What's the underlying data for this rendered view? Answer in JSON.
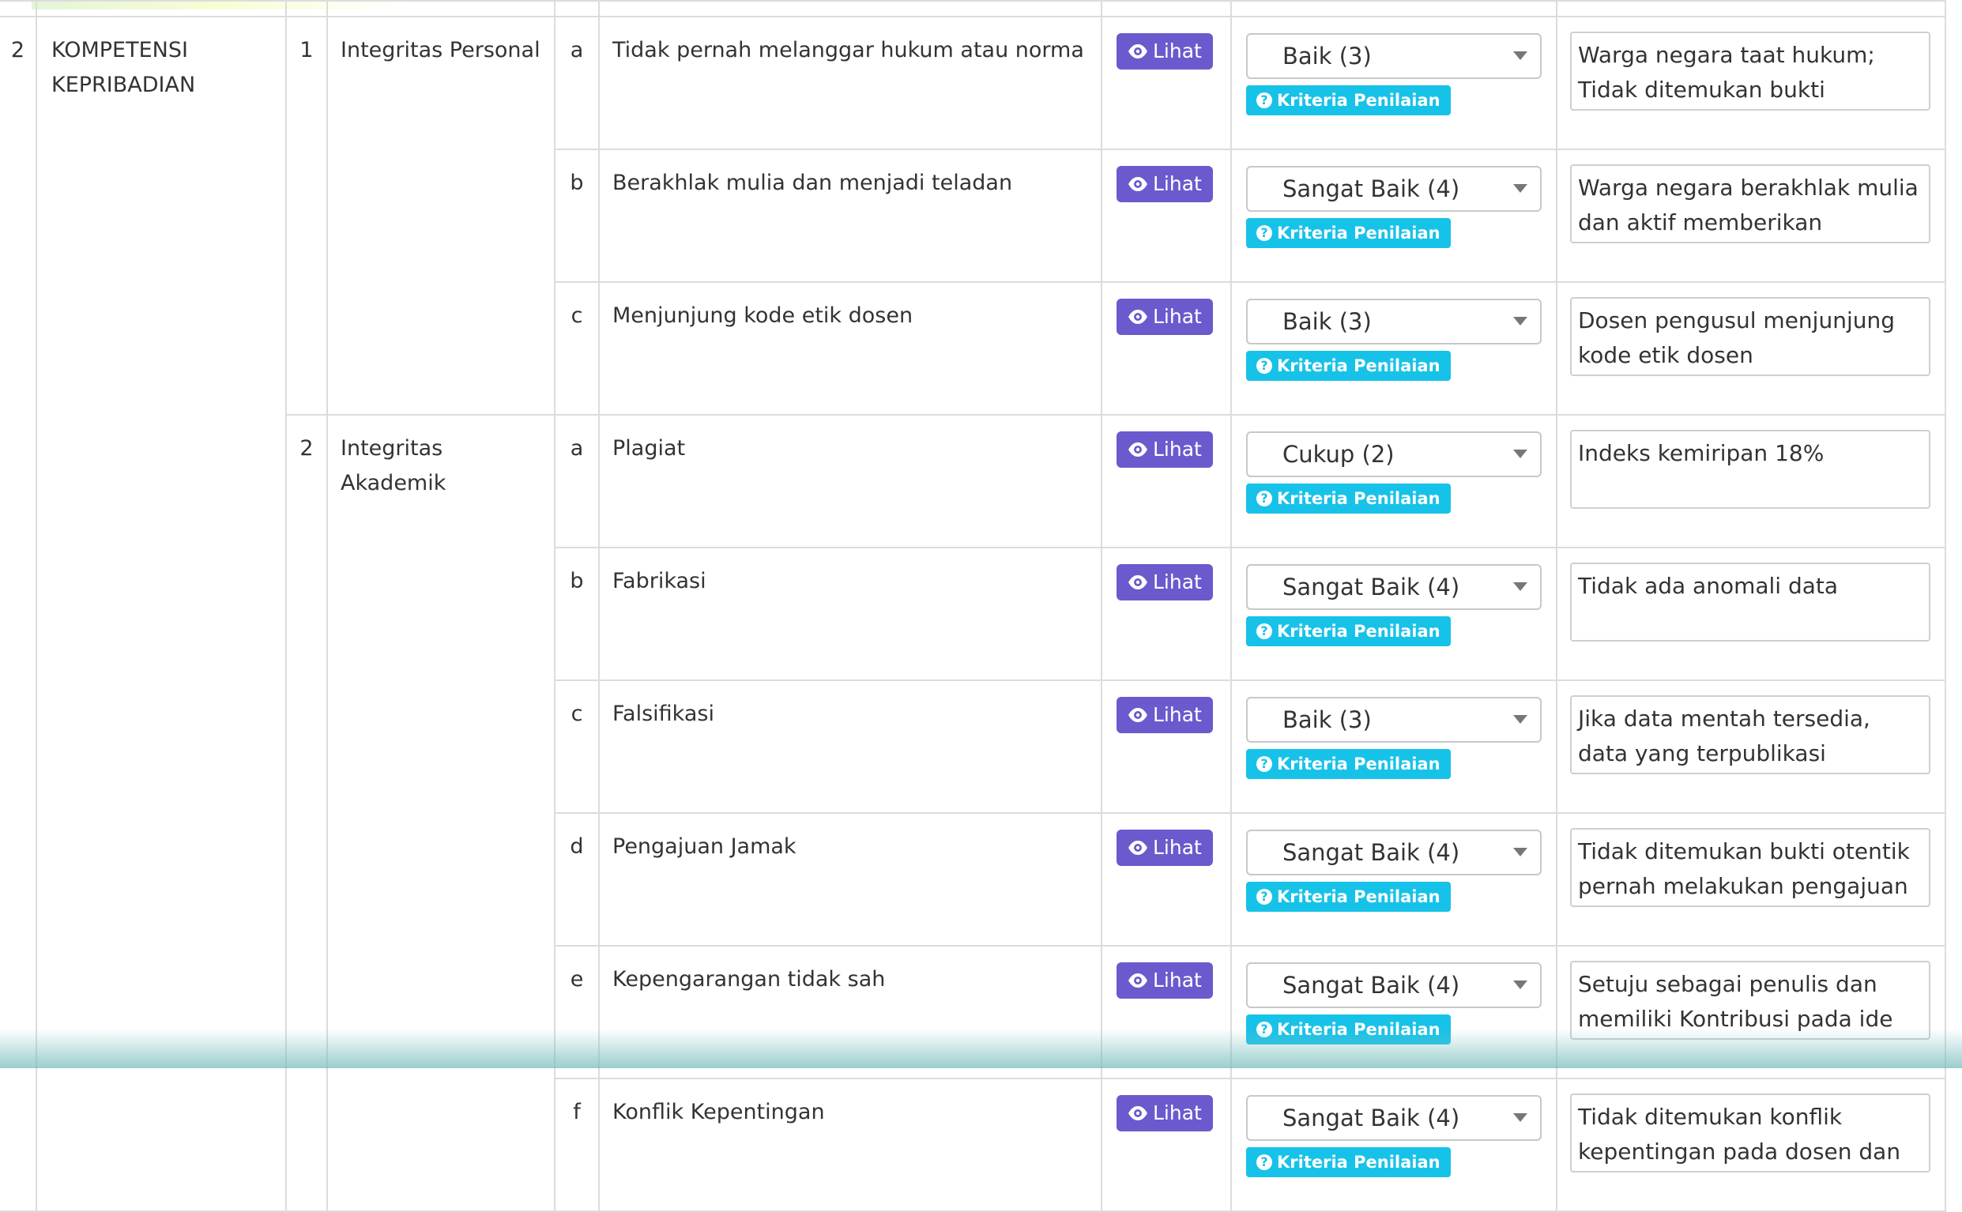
{
  "section": {
    "number": "2",
    "title": "KOMPETENSI KEPRIBADIAN",
    "view_button_label": "Lihat",
    "criteria_button_label": "Kriteria Penilaian",
    "subsections": [
      {
        "number": "1",
        "title": "Integritas Personal",
        "items": [
          {
            "letter": "a",
            "indicator": "Tidak pernah melanggar hukum atau norma",
            "score": "Baik (3)",
            "note": "Warga negara taat hukum;  Tidak ditemukan bukti kepeloloporan /"
          },
          {
            "letter": "b",
            "indicator": "Berakhlak mulia dan menjadi teladan",
            "score": "Sangat Baik (4)",
            "note": "Warga negara berakhlak mulia dan aktif memberikan keteladanan;"
          },
          {
            "letter": "c",
            "indicator": "Menjunjung kode etik dosen",
            "score": "Baik (3)",
            "note": "Dosen pengusul menjunjung kode etik dosen"
          }
        ]
      },
      {
        "number": "2",
        "title": "Integritas Akademik",
        "items": [
          {
            "letter": "a",
            "indicator": "Plagiat",
            "score": "Cukup (2)",
            "note": "Indeks kemiripan 18%"
          },
          {
            "letter": "b",
            "indicator": "Fabrikasi",
            "score": "Sangat Baik (4)",
            "note": "Tidak ada anomali data"
          },
          {
            "letter": "c",
            "indicator": "Falsifikasi",
            "score": "Baik (3)",
            "note": "Jika data mentah tersedia, data yang terpublikasi merupakan hasil"
          },
          {
            "letter": "d",
            "indicator": "Pengajuan Jamak",
            "score": "Sangat Baik (4)",
            "note": "Tidak ditemukan bukti otentik pernah melakukan pengajuan"
          },
          {
            "letter": "e",
            "indicator": "Kepengarangan tidak sah",
            "score": "Sangat Baik (4)",
            "note": "Setuju sebagai penulis dan memiliki Kontribusi pada ide"
          },
          {
            "letter": "f",
            "indicator": "Konflik Kepentingan",
            "score": "Sangat Baik (4)",
            "note": "Tidak ditemukan konflik kepentingan pada dosen dan"
          }
        ]
      }
    ]
  },
  "colors": {
    "view_button": "#6a5acd",
    "criteria_button": "#17c2e8",
    "border": "#dcdcdc",
    "text": "#333333"
  }
}
